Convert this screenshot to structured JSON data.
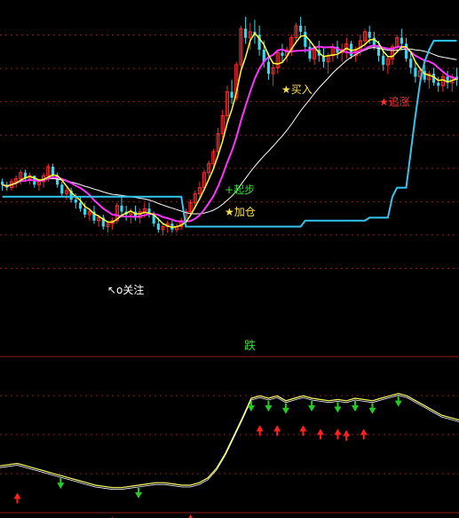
{
  "colors": {
    "background": "#000000",
    "grid": "#8a1f1f",
    "rise": "#ff2b2b",
    "fall": "#3ad7ee",
    "ma_fast": "#ffff33",
    "ma_mid": "#ff33ff",
    "ma_slow": "#ffffff",
    "stop_line": "#33c6ee",
    "osc_line": "#ffff66",
    "up_arrow": "#ff2020",
    "down_arrow": "#22cc22",
    "label_gold": "#ffe14a",
    "label_green": "#33dd33",
    "label_red": "#ff3333"
  },
  "upper_annotations": {
    "qibu": "起步",
    "jiacang": "加仓",
    "maru": "买入",
    "zhuizhang": "追涨",
    "guanzhu": "关注"
  },
  "lower_panel": {
    "title": "跌"
  },
  "chart_data": [
    {
      "type": "candlestick",
      "title": "",
      "xlabel": "",
      "ylabel": "",
      "grid": true,
      "n_bars": 100,
      "ylim": [
        0,
        100
      ],
      "candles": [
        [
          40,
          41,
          37,
          39
        ],
        [
          39,
          40,
          37,
          38
        ],
        [
          38,
          41,
          37,
          40
        ],
        [
          40,
          42,
          38,
          41
        ],
        [
          41,
          44,
          39,
          43
        ],
        [
          43,
          44,
          40,
          41
        ],
        [
          41,
          43,
          39,
          42
        ],
        [
          42,
          42,
          38,
          39
        ],
        [
          39,
          41,
          37,
          40
        ],
        [
          40,
          43,
          38,
          42
        ],
        [
          42,
          46,
          40,
          45
        ],
        [
          45,
          46,
          41,
          42
        ],
        [
          42,
          43,
          38,
          39
        ],
        [
          39,
          40,
          35,
          36
        ],
        [
          36,
          38,
          34,
          37
        ],
        [
          37,
          38,
          33,
          34
        ],
        [
          34,
          36,
          31,
          33
        ],
        [
          33,
          35,
          30,
          31
        ],
        [
          31,
          33,
          28,
          29
        ],
        [
          29,
          31,
          27,
          30
        ],
        [
          30,
          32,
          26,
          27
        ],
        [
          27,
          29,
          25,
          28
        ],
        [
          28,
          29,
          24,
          25
        ],
        [
          25,
          27,
          23,
          26
        ],
        [
          26,
          28,
          24,
          27
        ],
        [
          27,
          33,
          26,
          32
        ],
        [
          32,
          35,
          28,
          30
        ],
        [
          30,
          32,
          27,
          29
        ],
        [
          29,
          31,
          26,
          30
        ],
        [
          30,
          32,
          27,
          28
        ],
        [
          28,
          31,
          26,
          30
        ],
        [
          30,
          33,
          28,
          31
        ],
        [
          31,
          33,
          28,
          29
        ],
        [
          29,
          30,
          25,
          26
        ],
        [
          26,
          28,
          23,
          24
        ],
        [
          24,
          26,
          22,
          25
        ],
        [
          25,
          27,
          23,
          26
        ],
        [
          26,
          27,
          23,
          24
        ],
        [
          24,
          26,
          23,
          25
        ],
        [
          25,
          28,
          24,
          27
        ],
        [
          27,
          31,
          26,
          30
        ],
        [
          30,
          34,
          29,
          33
        ],
        [
          33,
          37,
          31,
          36
        ],
        [
          36,
          40,
          34,
          38
        ],
        [
          38,
          44,
          37,
          43
        ],
        [
          43,
          47,
          41,
          46
        ],
        [
          46,
          51,
          44,
          50
        ],
        [
          50,
          58,
          48,
          56
        ],
        [
          56,
          64,
          54,
          62
        ],
        [
          62,
          72,
          60,
          70
        ],
        [
          70,
          74,
          66,
          68
        ],
        [
          68,
          80,
          67,
          79
        ],
        [
          79,
          92,
          78,
          91
        ],
        [
          91,
          95,
          86,
          88
        ],
        [
          88,
          93,
          84,
          90
        ],
        [
          90,
          94,
          86,
          89
        ],
        [
          89,
          92,
          82,
          84
        ],
        [
          84,
          87,
          78,
          80
        ],
        [
          80,
          83,
          74,
          76
        ],
        [
          76,
          80,
          72,
          78
        ],
        [
          78,
          84,
          76,
          83
        ],
        [
          83,
          86,
          80,
          82
        ],
        [
          82,
          85,
          80,
          84
        ],
        [
          84,
          89,
          82,
          88
        ],
        [
          88,
          93,
          86,
          92
        ],
        [
          92,
          95,
          88,
          90
        ],
        [
          90,
          92,
          83,
          85
        ],
        [
          85,
          87,
          80,
          81
        ],
        [
          81,
          85,
          79,
          84
        ],
        [
          84,
          87,
          80,
          82
        ],
        [
          82,
          85,
          78,
          80
        ],
        [
          80,
          83,
          76,
          82
        ],
        [
          82,
          86,
          80,
          85
        ],
        [
          85,
          87,
          81,
          83
        ],
        [
          83,
          86,
          80,
          84
        ],
        [
          84,
          88,
          81,
          86
        ],
        [
          86,
          87,
          81,
          82
        ],
        [
          82,
          85,
          80,
          84
        ],
        [
          84,
          89,
          82,
          87
        ],
        [
          87,
          91,
          85,
          90
        ],
        [
          90,
          92,
          86,
          88
        ],
        [
          88,
          90,
          84,
          85
        ],
        [
          85,
          87,
          80,
          82
        ],
        [
          82,
          84,
          77,
          79
        ],
        [
          79,
          82,
          76,
          81
        ],
        [
          81,
          86,
          79,
          85
        ],
        [
          85,
          89,
          83,
          88
        ],
        [
          88,
          91,
          84,
          86
        ],
        [
          86,
          88,
          80,
          81
        ],
        [
          81,
          83,
          76,
          78
        ],
        [
          78,
          80,
          73,
          75
        ],
        [
          75,
          78,
          72,
          77
        ],
        [
          77,
          79,
          73,
          74
        ],
        [
          74,
          77,
          71,
          76
        ],
        [
          76,
          78,
          72,
          73
        ],
        [
          73,
          75,
          70,
          72
        ],
        [
          72,
          76,
          70,
          75
        ],
        [
          75,
          77,
          71,
          73
        ],
        [
          73,
          76,
          70,
          75
        ],
        [
          75,
          78,
          72,
          74
        ]
      ],
      "series": [
        {
          "name": "",
          "kind": "stop",
          "values": [
            35,
            35,
            35,
            35,
            35,
            35,
            35,
            35,
            35,
            35,
            35,
            35,
            35,
            35,
            35,
            35,
            35,
            35,
            35,
            35,
            35,
            35,
            35,
            35,
            35,
            35,
            35,
            35,
            35,
            35,
            35,
            35,
            35,
            35,
            35,
            35,
            35,
            35,
            35,
            35,
            25,
            25,
            25,
            25,
            25,
            25,
            25,
            25,
            25,
            25,
            25,
            25,
            25,
            25,
            25,
            25,
            25,
            25,
            25,
            25,
            25,
            25,
            25,
            25,
            25,
            25,
            27,
            27,
            27,
            27,
            27,
            27,
            27,
            27,
            27,
            27,
            27,
            27,
            27,
            27,
            28,
            28,
            28,
            28,
            28,
            35,
            38,
            38,
            38,
            50,
            62,
            73,
            80,
            84,
            87,
            87,
            87,
            87,
            87,
            87
          ]
        }
      ]
    },
    {
      "type": "line",
      "title": "跌",
      "xlabel": "",
      "ylabel": "",
      "grid": true,
      "ylim": [
        0,
        100
      ],
      "series": [
        {
          "name": "",
          "values": [
            30,
            31,
            32,
            30,
            28,
            26,
            24,
            22,
            20,
            18,
            16,
            14,
            13,
            12,
            12,
            13,
            14,
            15,
            16,
            16,
            15,
            14,
            14,
            16,
            20,
            28,
            40,
            55,
            70,
            86,
            88,
            86,
            88,
            84,
            86,
            88,
            86,
            85,
            84,
            85,
            84,
            86,
            85,
            84,
            86,
            88,
            90,
            88,
            84,
            80,
            76,
            72,
            70,
            68
          ]
        }
      ],
      "down_arrows_at": [
        7,
        16,
        29,
        31,
        33,
        36,
        39,
        41,
        43,
        46
      ],
      "up_arrows_at": [
        2,
        13,
        22,
        30,
        32,
        35,
        37,
        39,
        40,
        42
      ]
    }
  ]
}
